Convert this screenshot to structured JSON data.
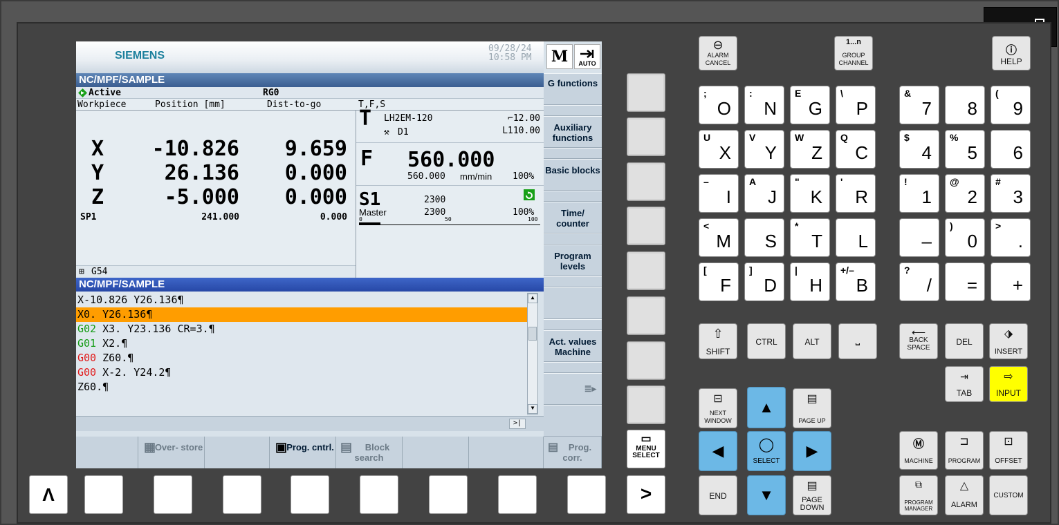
{
  "window": {
    "minimize": "minimize",
    "restore": "restore"
  },
  "header": {
    "brand": "SIEMENS",
    "date": "09/28/24",
    "time": "10:58 PM",
    "mode_icon": "M",
    "auto": "AUTO"
  },
  "path_bar": "NC/MPF/SAMPLE",
  "status": {
    "active": "Active",
    "reset": "RG0"
  },
  "columns": {
    "workpiece": "Workpiece",
    "position": "Position [mm]",
    "dist": "Dist-to-go",
    "tfs": "T,F,S"
  },
  "axes": [
    {
      "name": "X",
      "pos": "-10.826",
      "dist": "9.659"
    },
    {
      "name": "Y",
      "pos": "26.136",
      "dist": "0.000"
    },
    {
      "name": "Z",
      "pos": "-5.000",
      "dist": "0.000"
    }
  ],
  "spindle_row": {
    "name": "SP1",
    "pos": "241.000",
    "dist": "0.000"
  },
  "work_offset": "G54",
  "tool": {
    "letter": "T",
    "name": "LH2EM-120",
    "diameter": "⌐12.00",
    "edge": "D1",
    "length": "L110.00"
  },
  "feed": {
    "letter": "F",
    "value": "560.000",
    "actual": "560.000",
    "unit": "mm/min",
    "override": "100%"
  },
  "spindle": {
    "name": "S1",
    "set": "2300",
    "role": "Master",
    "actual": "2300",
    "override": "100%",
    "scale_min": "0",
    "scale_mid": "50",
    "scale_max": "100",
    "load_fraction": 0.12
  },
  "program_bar": "NC/MPF/SAMPLE",
  "code_lines": [
    {
      "prefix": "",
      "text": "X-10.826 Y26.136¶"
    },
    {
      "prefix": "",
      "text": "X0. Y26.136¶"
    },
    {
      "prefix": "G02",
      "text": " X3. Y23.136 CR=3.¶"
    },
    {
      "prefix": "G01",
      "text": " X2.¶"
    },
    {
      "prefix": "G00",
      "text": " Z60.¶"
    },
    {
      "prefix": "G00",
      "text": " X-2. Y24.2¶"
    },
    {
      "prefix": "",
      "text": "Z60.¶"
    }
  ],
  "right_softkeys": [
    "G functions",
    "Auxiliary functions",
    "Basic blocks",
    "Time/ counter",
    "Program levels",
    "",
    "Act. values Machine",
    ""
  ],
  "bottom_softkeys": [
    "",
    "Over- store",
    "",
    "Prog. cntrl.",
    "Block search",
    "",
    "",
    "Prog. corr."
  ],
  "keyboard": {
    "alarm_cancel": "ALARM CANCEL",
    "group_channel": "GROUP CHANNEL",
    "help": "HELP",
    "channel_digits": "1...n",
    "letters": [
      {
        "main": "O",
        "sub": ";"
      },
      {
        "main": "N",
        "sub": ":"
      },
      {
        "main": "G",
        "sub": "E"
      },
      {
        "main": "P",
        "sub": "\\"
      },
      {
        "main": "X",
        "sub": "U"
      },
      {
        "main": "Y",
        "sub": "V"
      },
      {
        "main": "Z",
        "sub": "W"
      },
      {
        "main": "C",
        "sub": "Q"
      },
      {
        "main": "I",
        "sub": "–"
      },
      {
        "main": "J",
        "sub": "A"
      },
      {
        "main": "K",
        "sub": "\""
      },
      {
        "main": "R",
        "sub": "'"
      },
      {
        "main": "M",
        "sub": "<"
      },
      {
        "main": "S",
        "sub": ""
      },
      {
        "main": "T",
        "sub": "*"
      },
      {
        "main": "L",
        "sub": ""
      },
      {
        "main": "F",
        "sub": "["
      },
      {
        "main": "D",
        "sub": "]"
      },
      {
        "main": "H",
        "sub": "|"
      },
      {
        "main": "B",
        "sub": "+/–"
      }
    ],
    "numbers": [
      {
        "main": "7",
        "sub": "&"
      },
      {
        "main": "8",
        "sub": ""
      },
      {
        "main": "9",
        "sub": "("
      },
      {
        "main": "4",
        "sub": "$"
      },
      {
        "main": "5",
        "sub": "%"
      },
      {
        "main": "6",
        "sub": ""
      },
      {
        "main": "1",
        "sub": "!"
      },
      {
        "main": "2",
        "sub": "@"
      },
      {
        "main": "3",
        "sub": "#"
      },
      {
        "main": "–",
        "sub": ""
      },
      {
        "main": "0",
        "sub": ")"
      },
      {
        "main": ".",
        "sub": ">"
      },
      {
        "main": "/",
        "sub": "?"
      },
      {
        "main": "=",
        "sub": ""
      },
      {
        "main": "+",
        "sub": ""
      }
    ],
    "shift": "SHIFT",
    "ctrl": "CTRL",
    "alt": "ALT",
    "backspace": "BACK SPACE",
    "del": "DEL",
    "insert": "INSERT",
    "tab": "TAB",
    "input": "INPUT",
    "next_window": "NEXT WINDOW",
    "page_up": "PAGE UP",
    "page_down": "PAGE DOWN",
    "end": "END",
    "select": "SELECT",
    "machine": "MACHINE",
    "program": "PROGRAM",
    "offset": "OFFSET",
    "program_manager": "PROGRAM MANAGER",
    "alarm": "ALARM",
    "custom": "CUSTOM",
    "menu_select": "MENU SELECT",
    "recall": "Λ",
    "next_menu": ">"
  },
  "colors": {
    "highlight": "#ff9d00",
    "g_green": "#149b14",
    "g_red": "#e11b1b",
    "input_yellow": "#ffff00",
    "nav_blue": "#6cb8e6"
  }
}
